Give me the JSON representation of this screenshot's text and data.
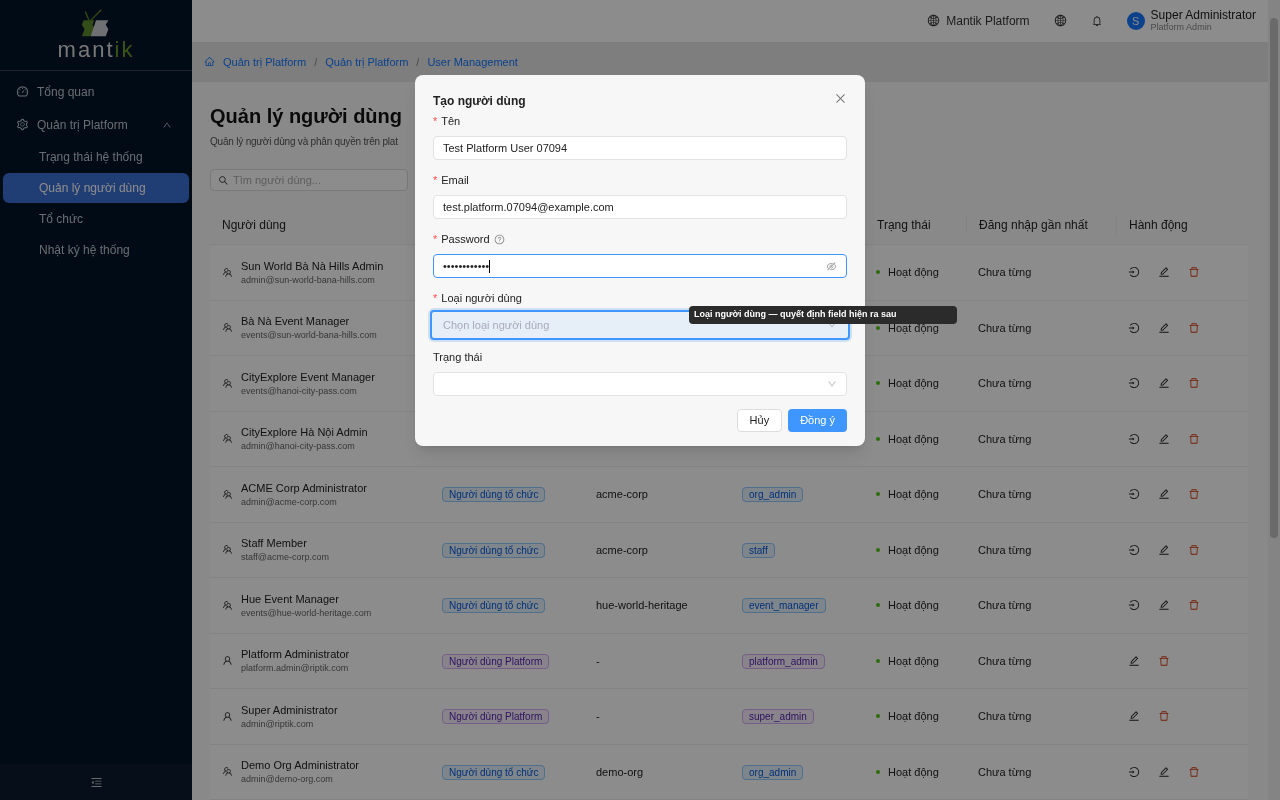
{
  "sidebar": {
    "logo_text_main": "mant",
    "logo_text_accent": "ik",
    "items": [
      {
        "label": "Tổng quan",
        "selected": false
      },
      {
        "label": "Quản trị Platform",
        "selected": false,
        "expanded": true,
        "children": [
          {
            "label": "Trạng thái hệ thống",
            "selected": false
          },
          {
            "label": "Quản lý người dùng",
            "selected": true
          },
          {
            "label": "Tổ chức",
            "selected": false
          },
          {
            "label": "Nhật ký hệ thống",
            "selected": false
          }
        ]
      }
    ]
  },
  "header": {
    "platform": "Mantik Platform",
    "user_initial": "S",
    "user_name": "Super Administrator",
    "user_role": "Platform Admin"
  },
  "breadcrumb": {
    "separator": "/",
    "items": [
      "Quản trị Platform",
      "Quản trị Platform",
      "User Management"
    ]
  },
  "page": {
    "title": "Quản lý người dùng",
    "subtitle": "Quản lý người dùng và phân quyền trên plat",
    "search": {
      "placeholder": "Tìm người dùng..."
    }
  },
  "table": {
    "columns": [
      "Người dùng",
      null,
      null,
      null,
      "Trạng thái",
      "Đăng nhập gần nhất",
      "Hành động"
    ],
    "rows": [
      {
        "name": "Sun World Bà Nà Hills Admin",
        "email": "admin@sun-world-bana-hills.com",
        "kind": "org",
        "status": "Hoạt động",
        "last_login": "Chưa từng",
        "can_impersonate": true
      },
      {
        "name": "Bà Nà Event Manager",
        "email": "events@sun-world-bana-hills.com",
        "kind": "org",
        "status": "Hoạt động",
        "last_login": "Chưa từng",
        "can_impersonate": true
      },
      {
        "name": "CityExplore Event Manager",
        "email": "events@hanoi-city-pass.com",
        "kind": "org",
        "status": "Hoạt động",
        "last_login": "Chưa từng",
        "can_impersonate": true
      },
      {
        "name": "CityExplore Hà Nội Admin",
        "email": "admin@hanoi-city-pass.com",
        "kind": "org",
        "status": "Hoạt động",
        "last_login": "Chưa từng",
        "can_impersonate": true
      },
      {
        "name": "ACME Corp Administrator",
        "email": "admin@acme-corp.com",
        "kind": "org",
        "type": "Người dùng tổ chức",
        "org": "acme-corp",
        "role": "org_admin",
        "status": "Hoạt động",
        "last_login": "Chưa từng",
        "can_impersonate": true
      },
      {
        "name": "Staff Member",
        "email": "staff@acme-corp.com",
        "kind": "org",
        "type": "Người dùng tổ chức",
        "org": "acme-corp",
        "role": "staff",
        "status": "Hoạt động",
        "last_login": "Chưa từng",
        "can_impersonate": true
      },
      {
        "name": "Hue Event Manager",
        "email": "events@hue-world-heritage.com",
        "kind": "org",
        "type": "Người dùng tổ chức",
        "org": "hue-world-heritage",
        "role": "event_manager",
        "status": "Hoạt động",
        "last_login": "Chưa từng",
        "can_impersonate": true
      },
      {
        "name": "Platform Administrator",
        "email": "platform.admin@riptik.com",
        "kind": "platform",
        "type": "Người dùng Platform",
        "org": "-",
        "role": "platform_admin",
        "status": "Hoạt động",
        "last_login": "Chưa từng",
        "can_impersonate": false
      },
      {
        "name": "Super Administrator",
        "email": "admin@riptik.com",
        "kind": "platform",
        "type": "Người dùng Platform",
        "org": "-",
        "role": "super_admin",
        "status": "Hoạt động",
        "last_login": "Chưa từng",
        "can_impersonate": false
      },
      {
        "name": "Demo Org Administrator",
        "email": "admin@demo-org.com",
        "kind": "org",
        "type": "Người dùng tổ chức",
        "org": "demo-org",
        "role": "org_admin",
        "status": "Hoạt động",
        "last_login": "Chưa từng",
        "can_impersonate": true
      }
    ]
  },
  "modal": {
    "title": "Tạo người dùng",
    "required_mark": "*",
    "fields": [
      {
        "kind": "text",
        "label": "Tên",
        "required": true,
        "value": "Test Platform User 07094",
        "focused": false
      },
      {
        "kind": "text",
        "label": "Email",
        "required": true,
        "value": "test.platform.07094@example.com",
        "focused": false
      },
      {
        "kind": "password",
        "label": "Password",
        "required": true,
        "help": true,
        "value": "••••••••••••",
        "focused": true
      },
      {
        "kind": "select",
        "label": "Loại người dùng",
        "required": true,
        "placeholder": "Chọn loại người dùng",
        "focused": true
      },
      {
        "kind": "select",
        "label": "Trạng thái",
        "required": false,
        "focused": false
      }
    ],
    "tooltip": "Loại người dùng — quyết định field hiện ra sau",
    "buttons": [
      {
        "label": "Hủy",
        "primary": false
      },
      {
        "label": "Đồng ý",
        "primary": true
      }
    ]
  }
}
